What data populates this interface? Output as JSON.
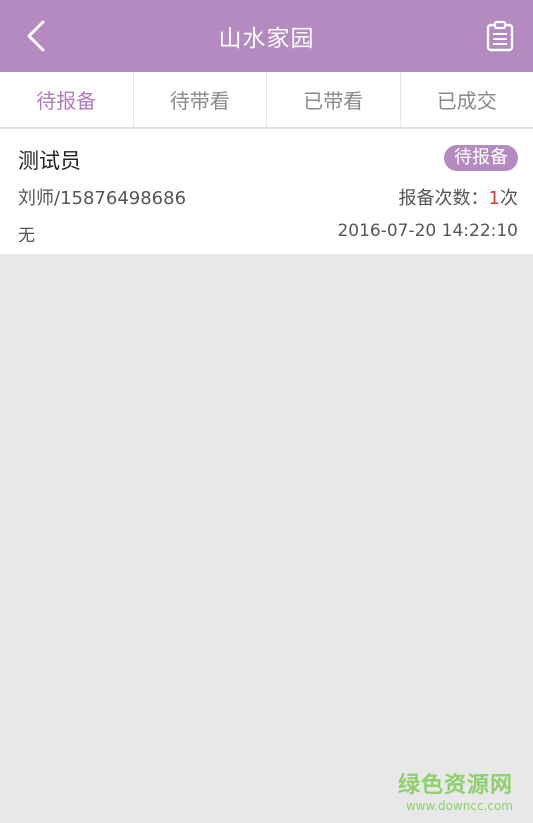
{
  "header": {
    "title": "山水家园",
    "back_icon": "chevron-left-icon",
    "action_icon": "clipboard-icon"
  },
  "tabs": [
    {
      "label": "待报备",
      "active": true
    },
    {
      "label": "待带看",
      "active": false
    },
    {
      "label": "已带看",
      "active": false
    },
    {
      "label": "已成交",
      "active": false
    }
  ],
  "record": {
    "name": "测试员",
    "status": "待报备",
    "agent": "刘师/15876498686",
    "count_label": "报备次数：",
    "count_value": "1",
    "count_unit": "次",
    "remark": "无",
    "time": "2016-07-20 14:22:10"
  },
  "watermark": {
    "text": "绿色资源网",
    "url": "www.downcc.com"
  },
  "colors": {
    "accent": "#b48bc0",
    "active_tab": "#b07cc0",
    "count_highlight": "#d23a3a"
  }
}
